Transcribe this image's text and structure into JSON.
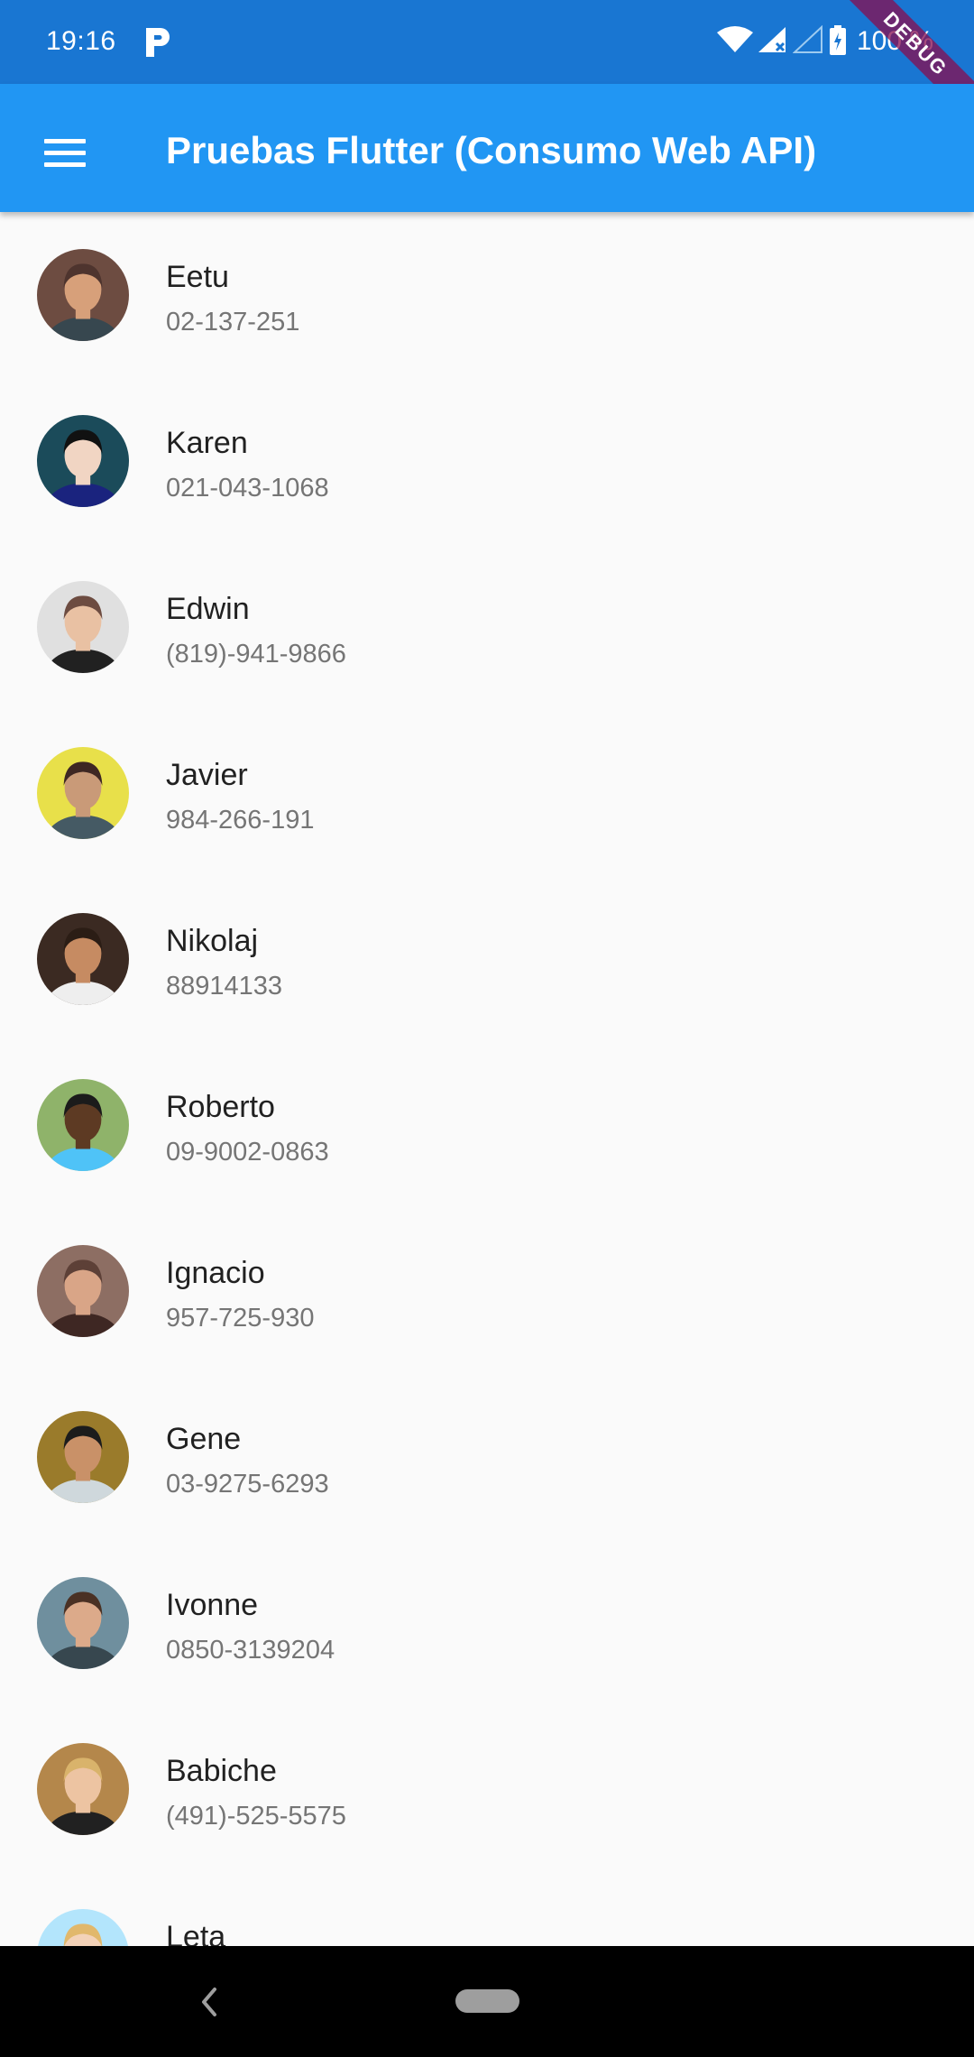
{
  "status_bar": {
    "time": "19:16",
    "battery": "100 %",
    "debug_banner": "DEBUG"
  },
  "app_bar": {
    "title": "Pruebas Flutter (Consumo Web API)",
    "menu_icon": "menu-icon",
    "color": "#2196F3",
    "status_color": "#1976D2"
  },
  "contacts": [
    {
      "name": "Eetu",
      "phone": "02-137-251",
      "bg": "#6d4c41",
      "skin": "#d7a07a",
      "hair": "#4e342e",
      "shirt": "#37474f"
    },
    {
      "name": "Karen",
      "phone": "021-043-1068",
      "bg": "#1b4b5a",
      "skin": "#f1d5c3",
      "hair": "#111111",
      "shirt": "#1a237e"
    },
    {
      "name": "Edwin",
      "phone": "(819)-941-9866",
      "bg": "#e0e0e0",
      "skin": "#e9c1a3",
      "hair": "#6d4c41",
      "shirt": "#212121"
    },
    {
      "name": "Javier",
      "phone": "984-266-191",
      "bg": "#e8e04a",
      "skin": "#c99a78",
      "hair": "#3e2723",
      "shirt": "#455a64"
    },
    {
      "name": "Nikolaj",
      "phone": "88914133",
      "bg": "#3b2a22",
      "skin": "#c68b62",
      "hair": "#2b1d15",
      "shirt": "#eeeeee"
    },
    {
      "name": "Roberto",
      "phone": "09-9002-0863",
      "bg": "#8fb36a",
      "skin": "#5d3a23",
      "hair": "#1b1b1b",
      "shirt": "#4fc3f7"
    },
    {
      "name": "Ignacio",
      "phone": "957-725-930",
      "bg": "#8d6e63",
      "skin": "#d9a587",
      "hair": "#5d4037",
      "shirt": "#3e2723"
    },
    {
      "name": "Gene",
      "phone": "03-9275-6293",
      "bg": "#9a7b2b",
      "skin": "#c99168",
      "hair": "#1c1c1c",
      "shirt": "#cfd8dc"
    },
    {
      "name": "Ivonne",
      "phone": "0850-3139204",
      "bg": "#6f8f9e",
      "skin": "#dcaa8a",
      "hair": "#4a3124",
      "shirt": "#37474f"
    },
    {
      "name": "Babiche",
      "phone": "(491)-525-5575",
      "bg": "#b4874b",
      "skin": "#edc4a2",
      "hair": "#d9b36b",
      "shirt": "#212121"
    },
    {
      "name": "Leta",
      "phone": "",
      "bg": "#b3e5fc",
      "skin": "#f3d2b8",
      "hair": "#e1b86c",
      "shirt": "#90a4ae"
    }
  ],
  "nav_bar": {
    "back_icon": "back-icon",
    "home_icon": "home-pill-icon"
  }
}
